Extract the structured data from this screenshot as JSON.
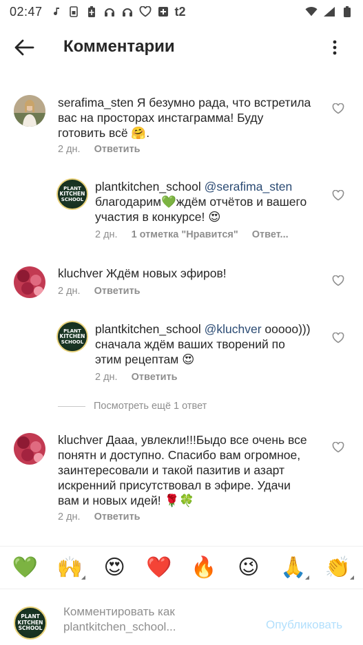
{
  "status": {
    "time": "02:47",
    "carrier": "t2"
  },
  "header": {
    "title": "Комментарии"
  },
  "comments": [
    {
      "user": "serafima_sten",
      "text": "Я безумно рада, что встретила вас на просторах инстаграмма! Буду готовить всё 🤗.",
      "line1": "Я безумно рада, что встретила",
      "line2": "вас на просторах инстаграмма! Буду",
      "line3": "готовить всё 🤗.",
      "time": "2 дн.",
      "reply_label": "Ответить"
    },
    {
      "user": "plantkitchen_school",
      "mention": "@serafima_sten",
      "line2": "благодарим💚ждём отчётов и вашего",
      "line3": "участия в конкурсе! 😍",
      "time": "2 дн.",
      "likes": "1 отметка \"Нравится\"",
      "reply_label": "Ответ..."
    },
    {
      "user": "kluchver",
      "line1": "Ждём новых эфиров!",
      "time": "2 дн.",
      "reply_label": "Ответить"
    },
    {
      "user": "plantkitchen_school",
      "mention": "@kluchver",
      "line1_rest": "ооооо)))",
      "line2": "сначала ждём ваших творений по",
      "line3": "этим рецептам 😍",
      "time": "2 дн.",
      "reply_label": "Ответить"
    },
    {
      "user": "kluchver",
      "line1": "Дааа, увлекли!!!Быдо все очень все",
      "line2": "понятн и доступно. Спасибо вам огромное,",
      "line3": "заинтересовали и такой пазитив и азарт",
      "line4": "искренний присутствовал в эфире. Удачи",
      "line5": "вам и новых идей! 🌹🍀",
      "time": "2 дн.",
      "reply_label": "Ответить"
    }
  ],
  "view_more": "Посмотреть ещё 1 ответ",
  "emojis": [
    "💚",
    "🙌",
    "😍",
    "❤️",
    "🔥",
    "😉",
    "🙏",
    "👏"
  ],
  "input": {
    "placeholder_line1": "Комментировать как",
    "placeholder_line2": "plantkitchen_school...",
    "publish_label": "Опубликовать",
    "logo_top": "PLANT",
    "logo_mid": "KITCHEN",
    "logo_bot": "SCHOOL"
  },
  "colors": {
    "accent_disabled": "#b2dffc",
    "secondary_text": "#8e8e8e",
    "mention": "#2a4a73"
  }
}
